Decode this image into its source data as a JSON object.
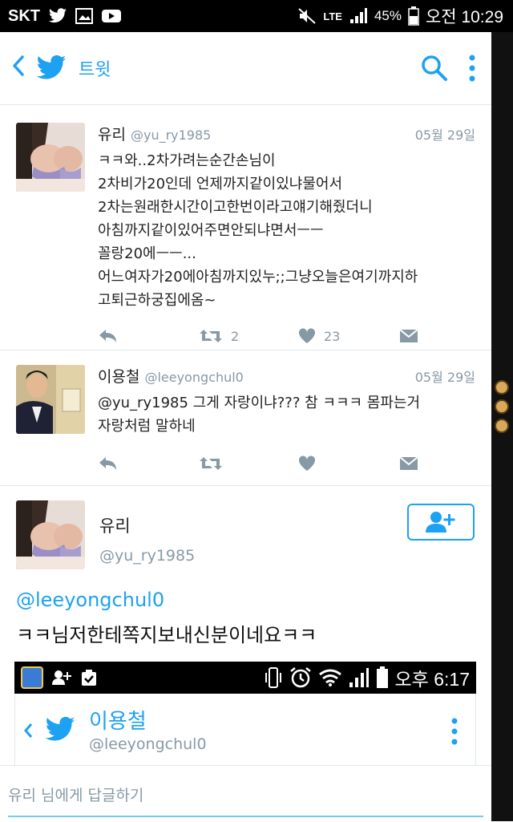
{
  "status_bar": {
    "carrier": "SKT",
    "network": "LTE",
    "battery": "45%",
    "time": "오전 10:29"
  },
  "header": {
    "title": "트윗"
  },
  "tweets": [
    {
      "name": "유리",
      "handle": "@yu_ry1985",
      "date": "05월 29일",
      "lines": [
        "ㅋㅋ와..2차가려는순간손님이",
        "2차비가20인데 언제까지같이있냐물어서",
        "2차는원래한시간이고한번이라고얘기해줬더니",
        "아침까지같이있어주면안되냐면서ㅡㅡ",
        "꼴랑20에ㅡㅡ...",
        "어느여자가20에아침까지있누;;그냥오늘은여기까지하",
        "고퇴근하궁집에옴~"
      ],
      "retweets": "2",
      "likes": "23"
    },
    {
      "name": "이용철",
      "handle": "@leeyongchul0",
      "date": "05월 29일",
      "lines": [
        "@yu_ry1985  그게 자랑이냐??? 참 ㅋㅋㅋ 몸파는거",
        "자랑처럼 말하네"
      ],
      "retweets": "",
      "likes": ""
    }
  ],
  "focus_tweet": {
    "name": "유리",
    "handle": "@yu_ry1985",
    "mention": "@leeyongchul0",
    "text": "ㅋㅋ님저한테쪽지보내신분이네요ㅋㅋ"
  },
  "embedded_screenshot": {
    "time": "오후 6:17",
    "name": "이용철",
    "handle": "@leeyongchul0"
  },
  "reply_bar": {
    "placeholder": "유리 님에게 답글하기"
  },
  "colors": {
    "twitter_blue": "#1da1f2",
    "gray": "#8899a6",
    "divider": "#e1e8ed"
  }
}
